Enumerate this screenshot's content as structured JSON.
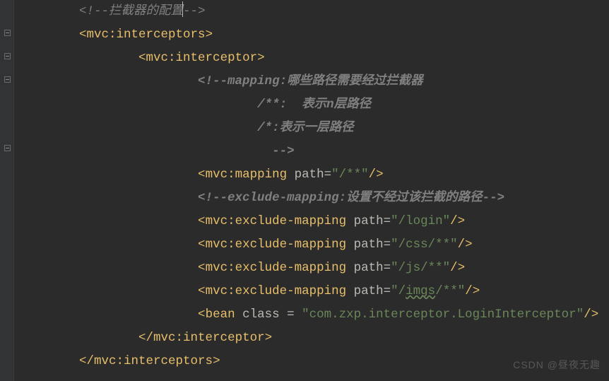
{
  "lines": [
    {
      "indent": 2,
      "type": "comment-full",
      "text": "<!--拦截器的配置"
    },
    {
      "indent": 2,
      "type": "open-tag",
      "tag": "mvc:interceptors",
      "attrs": []
    },
    {
      "indent": 4,
      "type": "open-tag",
      "tag": "mvc:interceptor",
      "attrs": []
    },
    {
      "indent": 6,
      "type": "comment-bold",
      "text": "<!--mapping:哪些路径需要经过拦截器"
    },
    {
      "indent": 8,
      "type": "comment-bold",
      "text": "/**:  表示n层路径"
    },
    {
      "indent": 8,
      "type": "comment-bold",
      "text": "/*:表示一层路径"
    },
    {
      "indent": 8,
      "type": "comment-bold",
      "text": "  -->"
    },
    {
      "indent": 6,
      "type": "selfclose-tag",
      "tag": "mvc:mapping",
      "attrs": [
        {
          "name": "path",
          "value": "/**"
        }
      ]
    },
    {
      "indent": 6,
      "type": "comment-bold",
      "text": "<!--exclude-mapping:设置不经过该拦截的路径-->"
    },
    {
      "indent": 6,
      "type": "selfclose-tag",
      "tag": "mvc:exclude-mapping",
      "attrs": [
        {
          "name": "path",
          "value": "/login"
        }
      ]
    },
    {
      "indent": 6,
      "type": "selfclose-tag",
      "tag": "mvc:exclude-mapping",
      "attrs": [
        {
          "name": "path",
          "value": "/css/**"
        }
      ]
    },
    {
      "indent": 6,
      "type": "selfclose-tag",
      "tag": "mvc:exclude-mapping",
      "attrs": [
        {
          "name": "path",
          "value": "/js/**"
        }
      ]
    },
    {
      "indent": 6,
      "type": "selfclose-tag",
      "tag": "mvc:exclude-mapping",
      "attrs": [
        {
          "name": "path",
          "value": "/",
          "squiggle": "imgs",
          "value2": "/**"
        }
      ]
    },
    {
      "indent": 6,
      "type": "selfclose-tag-sp",
      "tag": "bean",
      "attrs": [
        {
          "name": "class",
          "value": "com.zxp.interceptor.LoginInterceptor"
        }
      ]
    },
    {
      "indent": 4,
      "type": "close-tag",
      "tag": "mvc:interceptor"
    },
    {
      "indent": 2,
      "type": "close-tag",
      "tag": "mvc:interceptors"
    }
  ],
  "comment_end_caret": "-->",
  "watermark": "CSDN @昼夜无趣"
}
